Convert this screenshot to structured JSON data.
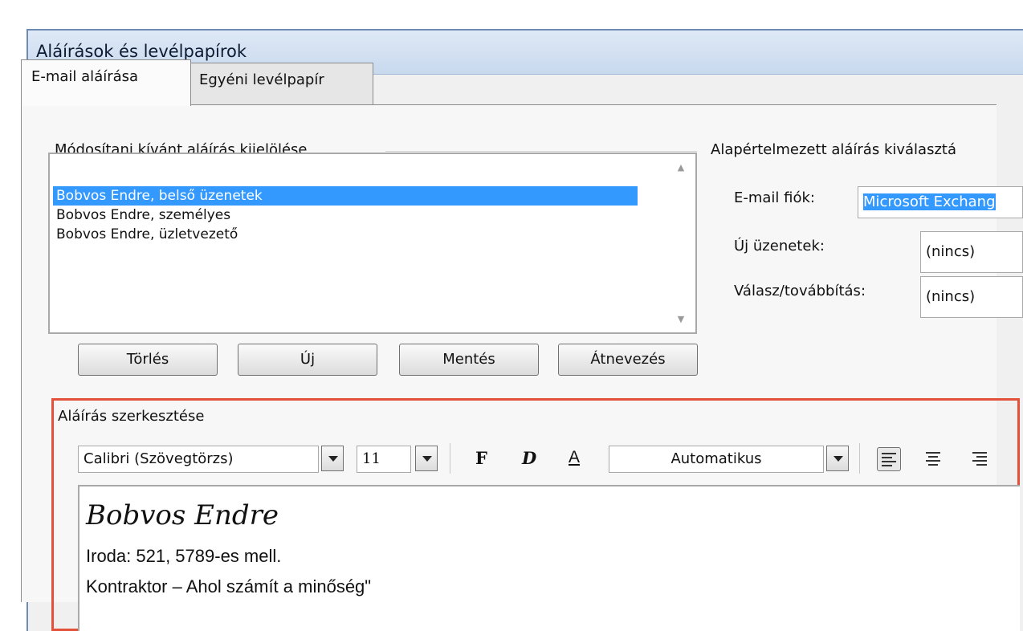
{
  "dialog": {
    "title": "Aláírások és levélpapírok"
  },
  "tabs": [
    {
      "label": "E-mail aláírása",
      "active": true
    },
    {
      "label": "Egyéni levélpapír",
      "active": false
    }
  ],
  "select_signature": {
    "group_label": "Módosítani kívánt aláírás kijelölése",
    "items": [
      {
        "label": "Bobvos Endre, belső üzenetek",
        "selected": true
      },
      {
        "label": "Bobvos Endre, személyes",
        "selected": false
      },
      {
        "label": "Bobvos Endre, üzletvezető",
        "selected": false
      }
    ],
    "buttons": {
      "delete": "Törlés",
      "new": "Új",
      "save": "Mentés",
      "rename": "Átnevezés"
    }
  },
  "default_signature": {
    "group_label": "Alapértelmezett aláírás kiválasztá",
    "account_label": "E-mail fiók:",
    "account_value": "Microsoft Exchang",
    "new_messages_label": "Új üzenetek:",
    "new_messages_value": "(nincs)",
    "replies_label": "Válasz/továbbítás:",
    "replies_value": "(nincs)"
  },
  "edit_signature": {
    "group_label": "Aláírás szerkesztése",
    "font": "Calibri (Szövegtörzs)",
    "size": "11",
    "bold": "F",
    "italic": "D",
    "underline": "A",
    "color": "Automatikus",
    "content": {
      "name": "Bobvos Endre",
      "line1": "Iroda: 521, 5789-es mell.",
      "line2": "Kontraktor – Ahol számít a minőség\""
    }
  },
  "colors": {
    "selection": "#3399ff",
    "highlight_border": "#e3513a"
  },
  "icons": [
    "dropdown-arrow-icon",
    "align-left-icon",
    "align-center-icon",
    "align-right-icon",
    "scroll-up-icon",
    "scroll-down-icon"
  ]
}
